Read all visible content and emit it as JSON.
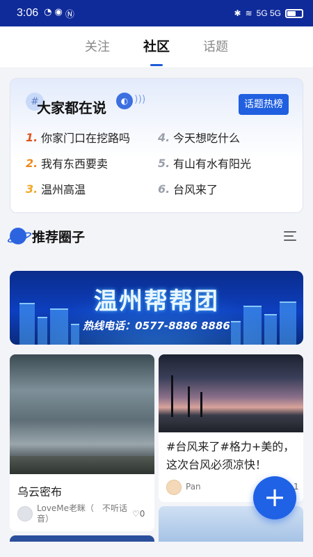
{
  "status_bar": {
    "time": "3:06",
    "network_icons": "5G 5G"
  },
  "tabs": [
    {
      "label": "关注",
      "active": false
    },
    {
      "label": "社区",
      "active": true
    },
    {
      "label": "话题",
      "active": false
    }
  ],
  "hot": {
    "title": "大家都在说",
    "rank_button": "话题热榜",
    "topics": [
      {
        "num": "1.",
        "text": "你家门口在挖路吗",
        "color": "#e2531f"
      },
      {
        "num": "4.",
        "text": "今天想吃什么",
        "color": "#9aa0aa"
      },
      {
        "num": "2.",
        "text": "我有东西要卖",
        "color": "#ef8a1b"
      },
      {
        "num": "5.",
        "text": "有山有水有阳光",
        "color": "#9aa0aa"
      },
      {
        "num": "3.",
        "text": "温州高温",
        "color": "#f0a92a"
      },
      {
        "num": "6.",
        "text": "台风来了",
        "color": "#9aa0aa"
      }
    ]
  },
  "recommend": {
    "title": "推荐圈子"
  },
  "banner": {
    "title": "温州帮帮团",
    "phone": "热线电话：0577-8886 8886"
  },
  "posts": [
    {
      "title": "乌云密布",
      "author": "LoveMe老眯（　不听话音）",
      "likes": "0"
    },
    {
      "title": "#台风来了#格力+美的，这次台风必须凉快！",
      "author": "Pan",
      "likes": "1"
    }
  ],
  "fab": {
    "label": "+"
  }
}
